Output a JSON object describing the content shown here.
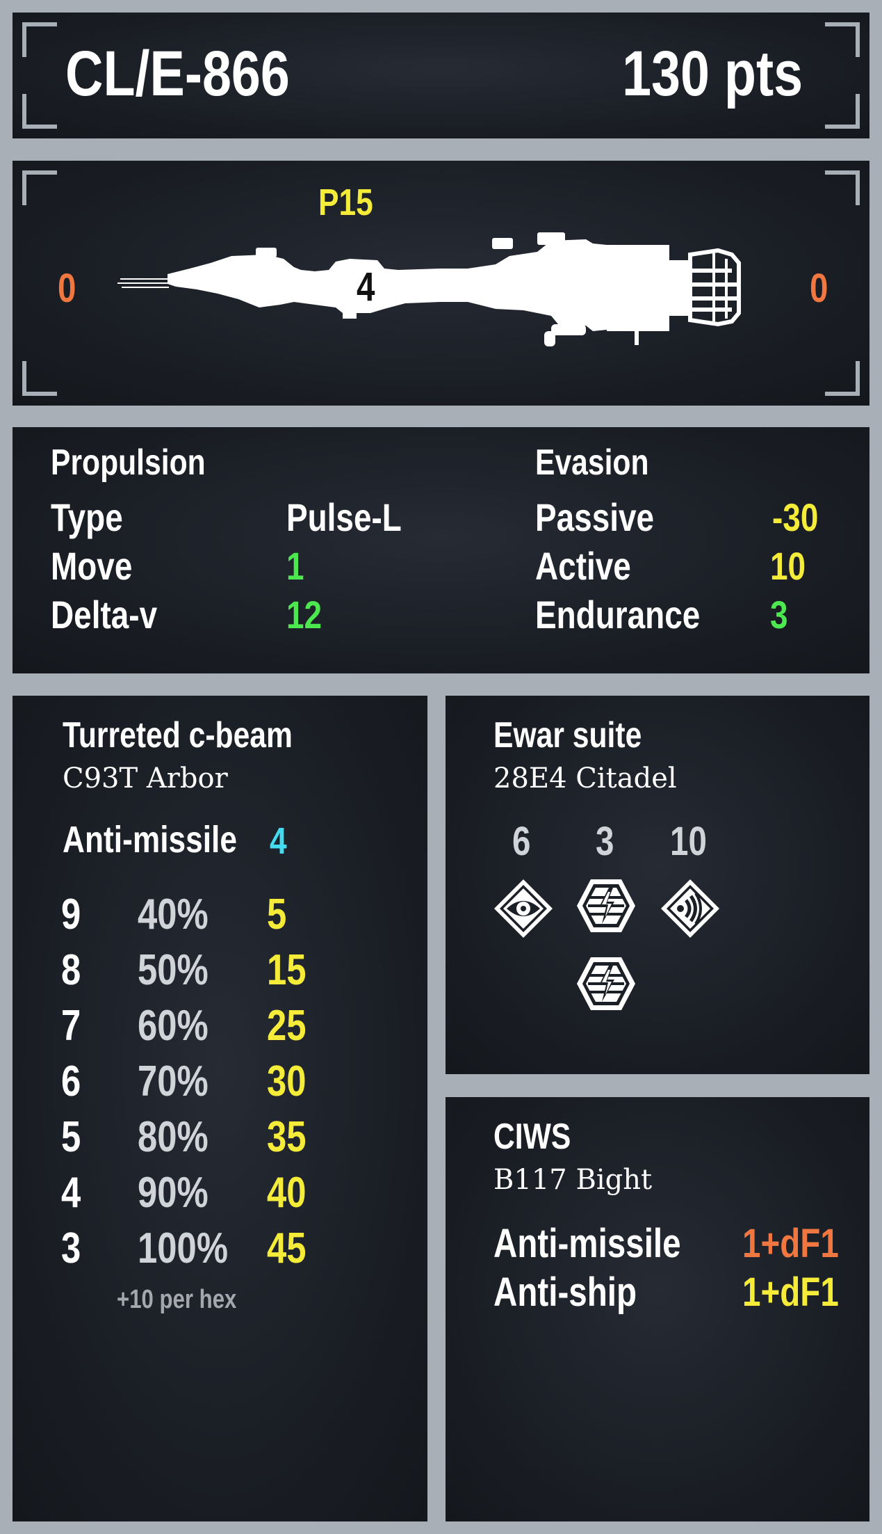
{
  "header": {
    "designation": "CL/E-866",
    "points": "130 pts"
  },
  "ship": {
    "profile": "P15",
    "center_value": "4",
    "left_value": "0",
    "right_value": "0",
    "image": "ship-silhouette"
  },
  "propulsion": {
    "title": "Propulsion",
    "rows": [
      {
        "label": "Type",
        "value": "Pulse-L"
      },
      {
        "label": "Move",
        "value": "1"
      },
      {
        "label": "Delta-v",
        "value": "12"
      }
    ]
  },
  "evasion": {
    "title": "Evasion",
    "rows": [
      {
        "label": "Passive",
        "value": "-30"
      },
      {
        "label": "Active",
        "value": "10"
      },
      {
        "label": "Endurance",
        "value": "3"
      }
    ]
  },
  "weapon": {
    "title": "Turreted c-beam",
    "model": "C93T Arbor",
    "anti_missile_label": "Anti-missile",
    "anti_missile_value": "4",
    "table": [
      {
        "range": "9",
        "chance": "40%",
        "damage": "5"
      },
      {
        "range": "8",
        "chance": "50%",
        "damage": "15"
      },
      {
        "range": "7",
        "chance": "60%",
        "damage": "25"
      },
      {
        "range": "6",
        "chance": "70%",
        "damage": "30"
      },
      {
        "range": "5",
        "chance": "80%",
        "damage": "35"
      },
      {
        "range": "4",
        "chance": "90%",
        "damage": "40"
      },
      {
        "range": "3",
        "chance": "100%",
        "damage": "45"
      }
    ],
    "note": "+10 per hex"
  },
  "ewar": {
    "title": "Ewar suite",
    "model": "28E4 Citadel",
    "values": [
      "6",
      "3",
      "10"
    ],
    "icons": [
      "eye-sensor-icon",
      "jamming-hex-icon",
      "signal-wave-icon",
      "jamming-hex-icon"
    ]
  },
  "ciws": {
    "title": "CIWS",
    "model": "B117 Bight",
    "rows": [
      {
        "label": "Anti-missile",
        "value": "1+dF1"
      },
      {
        "label": "Anti-ship",
        "value": "1+dF1"
      }
    ]
  },
  "colors": {
    "panel": "#1b1f26",
    "frame": "#a9afb7",
    "yellow": "#f5ec3a",
    "green": "#4de84f",
    "orange": "#f07840",
    "cyan": "#43dbef"
  }
}
